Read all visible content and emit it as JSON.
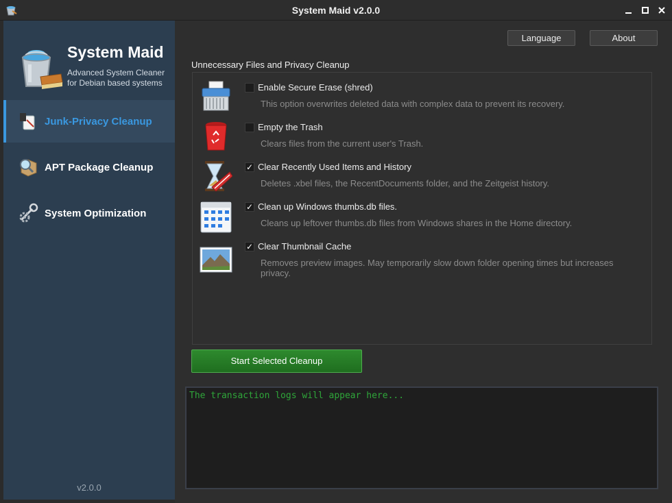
{
  "window": {
    "title": "System Maid v2.0.0"
  },
  "sidebar": {
    "brand": {
      "name": "System Maid",
      "description_line1": "Advanced System Cleaner",
      "description_line2": "for Debian based systems"
    },
    "items": [
      {
        "label": "Junk-Privacy Cleanup",
        "icon": "broom-icon",
        "active": true
      },
      {
        "label": "APT Package Cleanup",
        "icon": "package-magnifier-icon",
        "active": false
      },
      {
        "label": "System Optimization",
        "icon": "tools-gear-icon",
        "active": false
      }
    ],
    "version": "v2.0.0"
  },
  "header": {
    "language_label": "Language",
    "about_label": "About"
  },
  "main": {
    "section_title": "Unnecessary Files and Privacy Cleanup",
    "options": [
      {
        "label": "Enable Secure Erase (shred)",
        "description": "This option overwrites deleted data with complex data to prevent its recovery.",
        "checked": false,
        "icon": "shredder-icon",
        "check_mark": ""
      },
      {
        "label": "Empty the Trash",
        "description": "Clears files from the current user's Trash.",
        "checked": false,
        "icon": "trash-icon",
        "check_mark": ""
      },
      {
        "label": "Clear Recently Used Items and History",
        "description": "Deletes .xbel files, the RecentDocuments folder, and the Zeitgeist history.",
        "checked": true,
        "icon": "hourglass-eraser-icon",
        "check_mark": "✓"
      },
      {
        "label": "Clean up Windows thumbs.db files.",
        "description": "Cleans up leftover thumbs.db files from Windows shares in the Home directory.",
        "checked": true,
        "icon": "thumbnail-grid-icon",
        "check_mark": "✓"
      },
      {
        "label": "Clear Thumbnail Cache",
        "description": "Removes preview images. May temporarily slow down folder opening times but increases privacy.",
        "checked": true,
        "icon": "landscape-image-icon",
        "check_mark": "✓"
      }
    ],
    "start_button_label": "Start Selected Cleanup",
    "log_placeholder": "The transaction logs will appear here..."
  },
  "colors": {
    "sidebar_bg": "#2c3e50",
    "accent": "#3a98e0",
    "start_button": "#267d26",
    "log_text": "#2fa63a"
  }
}
